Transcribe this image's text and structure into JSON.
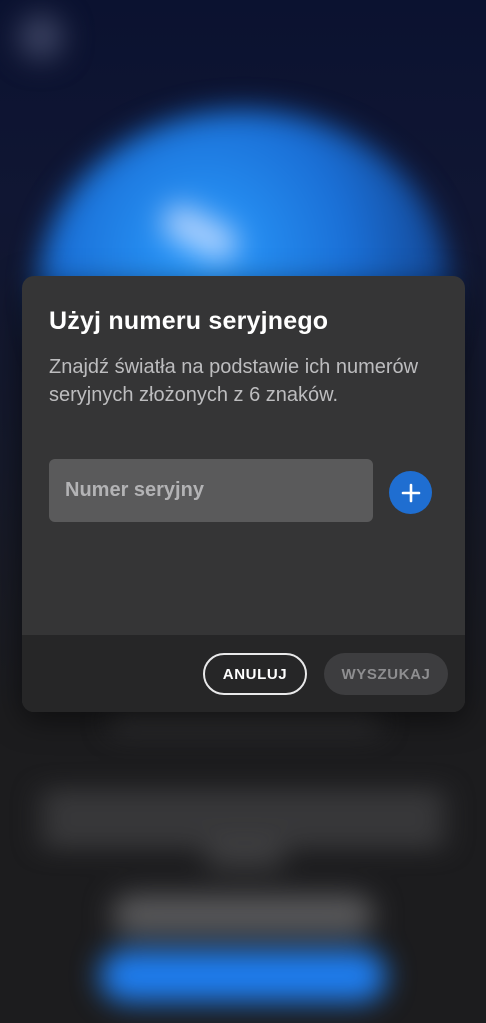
{
  "dialog": {
    "title": "Użyj numeru seryjnego",
    "description": "Znajdź światła na podstawie ich numerów seryjnych złożonych z 6 znaków.",
    "serial_input": {
      "placeholder": "Numer seryjny",
      "value": ""
    },
    "add_button_icon": "plus-icon",
    "cancel_label": "ANULUJ",
    "search_label": "WYSZUKAJ"
  },
  "colors": {
    "dialog_bg": "#353536",
    "footer_bg": "#262627",
    "accent": "#1f6ed1",
    "input_bg": "#5a5a5b"
  }
}
